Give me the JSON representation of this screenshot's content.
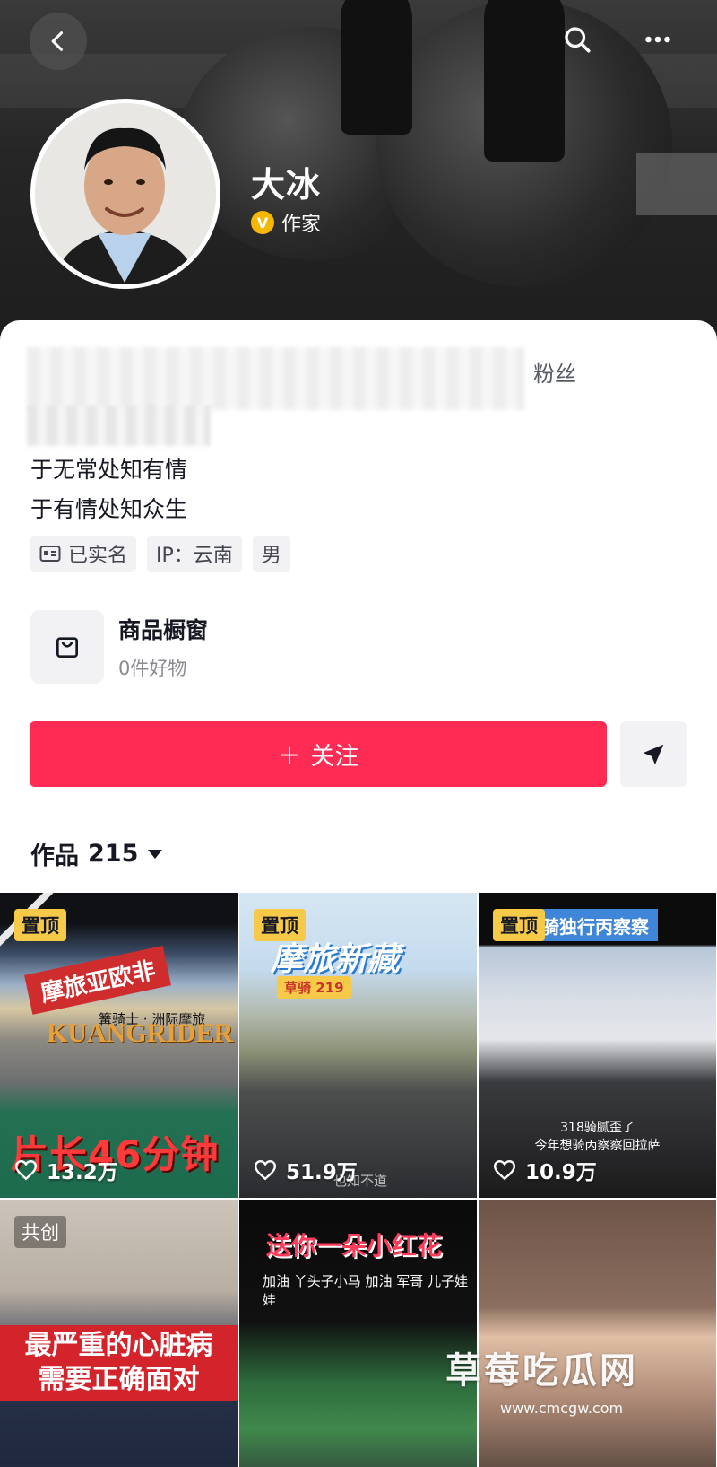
{
  "header": {
    "back_icon": "chevron-left-icon",
    "search_icon": "search-icon",
    "more_icon": "more-horizontal-icon"
  },
  "profile": {
    "name": "大冰",
    "verify_badge": "V",
    "verify_title": "作家",
    "fans_label": "粉丝",
    "bio_line1": "于无常处知有情",
    "bio_line2": "于有情处知众生",
    "tags": {
      "realname": "已实名",
      "ip": "IP：云南",
      "gender": "男"
    }
  },
  "shop": {
    "title": "商品橱窗",
    "subtitle": "0件好物",
    "icon": "shopping-bag-icon"
  },
  "actions": {
    "follow_plus": "＋",
    "follow_label": "关注",
    "share_icon": "send-icon"
  },
  "works": {
    "label": "作品",
    "count": "215",
    "dropdown_icon": "caret-down-icon"
  },
  "videos": [
    {
      "badge": "置顶",
      "likes": "13.2万",
      "title": "摩旅亚欧非",
      "subtitle": "篝骑士 · 洲际摩旅",
      "brand": "KUANGRIDER",
      "overlay": "片长46分钟"
    },
    {
      "badge": "置顶",
      "likes": "51.9万",
      "title": "摩旅新藏",
      "tag": "草骑 219",
      "caption": "也知不道"
    },
    {
      "badge": "置顶",
      "likes": "10.9万",
      "banner": "骑独行丙察察",
      "caption1": "318骑腻歪了",
      "caption2": "今年想骑丙察察回拉萨"
    },
    {
      "badge": "共创",
      "banner_line1": "最严重的心脏病",
      "banner_line2": "需要正确面对"
    },
    {
      "title": "送你一朵小红花",
      "subtitle": "加油  丫头子小马  加油  军哥  儿子娃娃"
    },
    {}
  ],
  "watermark": {
    "text": "草莓吃瓜网",
    "url": "www.cmcgw.com"
  },
  "colors": {
    "accent": "#fe2c55",
    "pin": "#f7c948",
    "verify": "#f5b800"
  }
}
